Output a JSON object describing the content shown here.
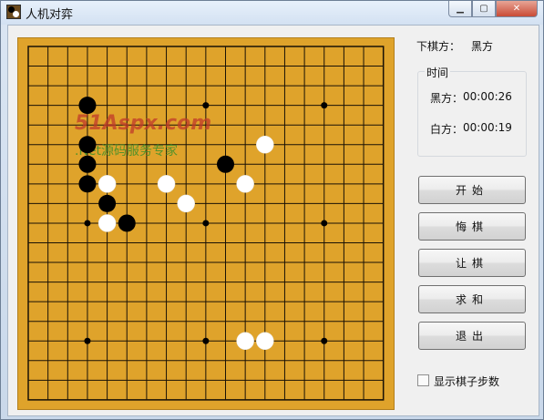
{
  "window": {
    "title": "人机对弈",
    "min_glyph": "▁",
    "max_glyph": "▢",
    "close_glyph": "✕"
  },
  "board": {
    "size": 19,
    "line_color": "#1a1206",
    "board_color": "#dfa32b",
    "star_points": [
      [
        9,
        3
      ],
      [
        15,
        3
      ],
      [
        3,
        9
      ],
      [
        9,
        9
      ],
      [
        15,
        9
      ],
      [
        3,
        15
      ],
      [
        9,
        15
      ],
      [
        15,
        15
      ]
    ],
    "black_stones": [
      [
        3,
        3
      ],
      [
        3,
        5
      ],
      [
        3,
        6
      ],
      [
        3,
        7
      ],
      [
        4,
        8
      ],
      [
        5,
        9
      ],
      [
        10,
        6
      ]
    ],
    "white_stones": [
      [
        12,
        5
      ],
      [
        4,
        7
      ],
      [
        7,
        7
      ],
      [
        11,
        7
      ],
      [
        8,
        8
      ],
      [
        4,
        9
      ],
      [
        11,
        15
      ],
      [
        12,
        15
      ]
    ],
    "watermark_brand": "51Aspx.com",
    "watermark_sub": ".Net源码服务专家"
  },
  "status": {
    "turn_label": "下棋方：",
    "turn_value": "黑方"
  },
  "timer": {
    "legend": "时间",
    "black_label": "黑方：",
    "black_time": "00:00:26",
    "white_label": "白方：",
    "white_time": "00:00:19"
  },
  "buttons": {
    "start": "开始",
    "undo": "悔棋",
    "handicap": "让棋",
    "draw": "求和",
    "exit": "退出"
  },
  "options": {
    "show_steps_label": "显示棋子步数",
    "show_steps_checked": false
  }
}
